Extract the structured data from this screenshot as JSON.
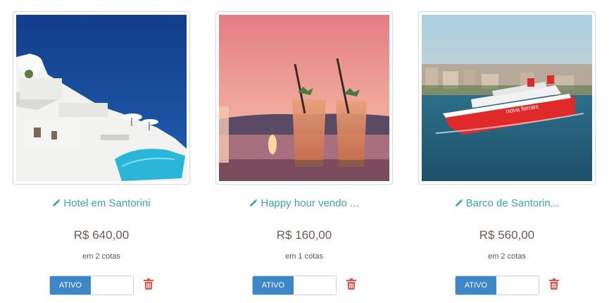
{
  "currency_color": "#6b5a55",
  "accent_color": "#3aa7a5",
  "toggle_color": "#3b87c8",
  "delete_color": "#e0534d",
  "cards": [
    {
      "title": "Hotel em Santorini",
      "price": "R$ 640,00",
      "quota": "em 2 cotas",
      "status": "ATIVO",
      "image": "santorini-hotel-pool",
      "edit_icon": "pencil-icon",
      "delete_icon": "trash-icon"
    },
    {
      "title": "Happy hour vendo ...",
      "price": "R$ 160,00",
      "quota": "em 1 cotas",
      "status": "ATIVO",
      "image": "cocktails-sunset",
      "edit_icon": "pencil-icon",
      "delete_icon": "trash-icon"
    },
    {
      "title": "Barco de Santorin...",
      "price": "R$ 560,00",
      "quota": "em 2 cotas",
      "status": "ATIVO",
      "image": "ferry-boat-harbor",
      "edit_icon": "pencil-icon",
      "delete_icon": "trash-icon"
    }
  ]
}
